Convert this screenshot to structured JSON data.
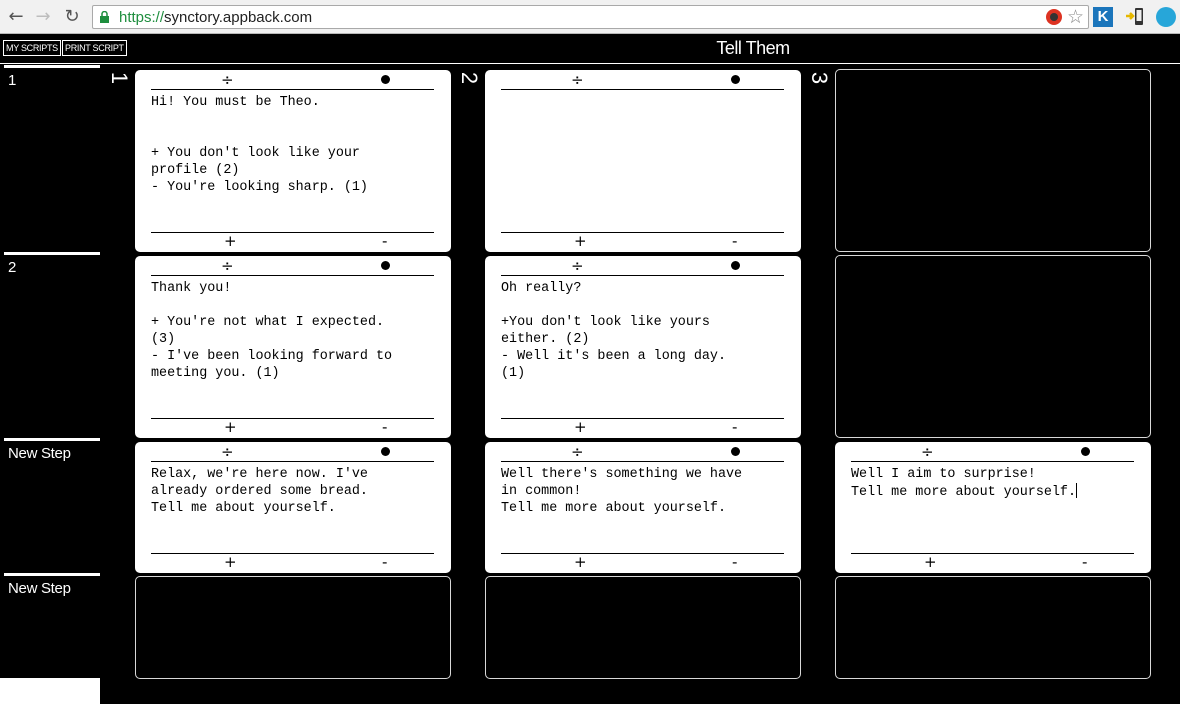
{
  "browser": {
    "url_scheme": "https://",
    "url_host": "synctory.appback.com",
    "ext_k_label": "K"
  },
  "header": {
    "my_scripts_label": "MY SCRIPTS",
    "print_script_label": "PRINT SCRIPT",
    "title": "Tell Them"
  },
  "rows": [
    {
      "label": "1"
    },
    {
      "label": "2"
    },
    {
      "label": "New Step"
    },
    {
      "label": "New Step"
    }
  ],
  "columns": [
    "1",
    "2",
    "3"
  ],
  "card_controls": {
    "split_symbol": "÷",
    "plus_label": "+",
    "minus_label": "-"
  },
  "cards": {
    "r1c1": "Hi! You must be Theo.\n\n\n+ You don't look like your\nprofile (2)\n- You're looking sharp. (1)",
    "r1c2": "",
    "r2c1": "Thank you!\n\n+ You're not what I expected.\n(3)\n- I've been looking forward to\nmeeting you. (1)",
    "r2c2": "Oh really?\n\n+You don't look like yours\neither. (2)\n- Well it's been a long day.\n(1)",
    "r3c1": "Relax, we're here now. I've\nalready ordered some bread.\nTell me about yourself.",
    "r3c2": "Well there's something we have\nin common!\nTell me more about yourself.",
    "r3c3": "Well I aim to surprise!\nTell me more about yourself."
  }
}
